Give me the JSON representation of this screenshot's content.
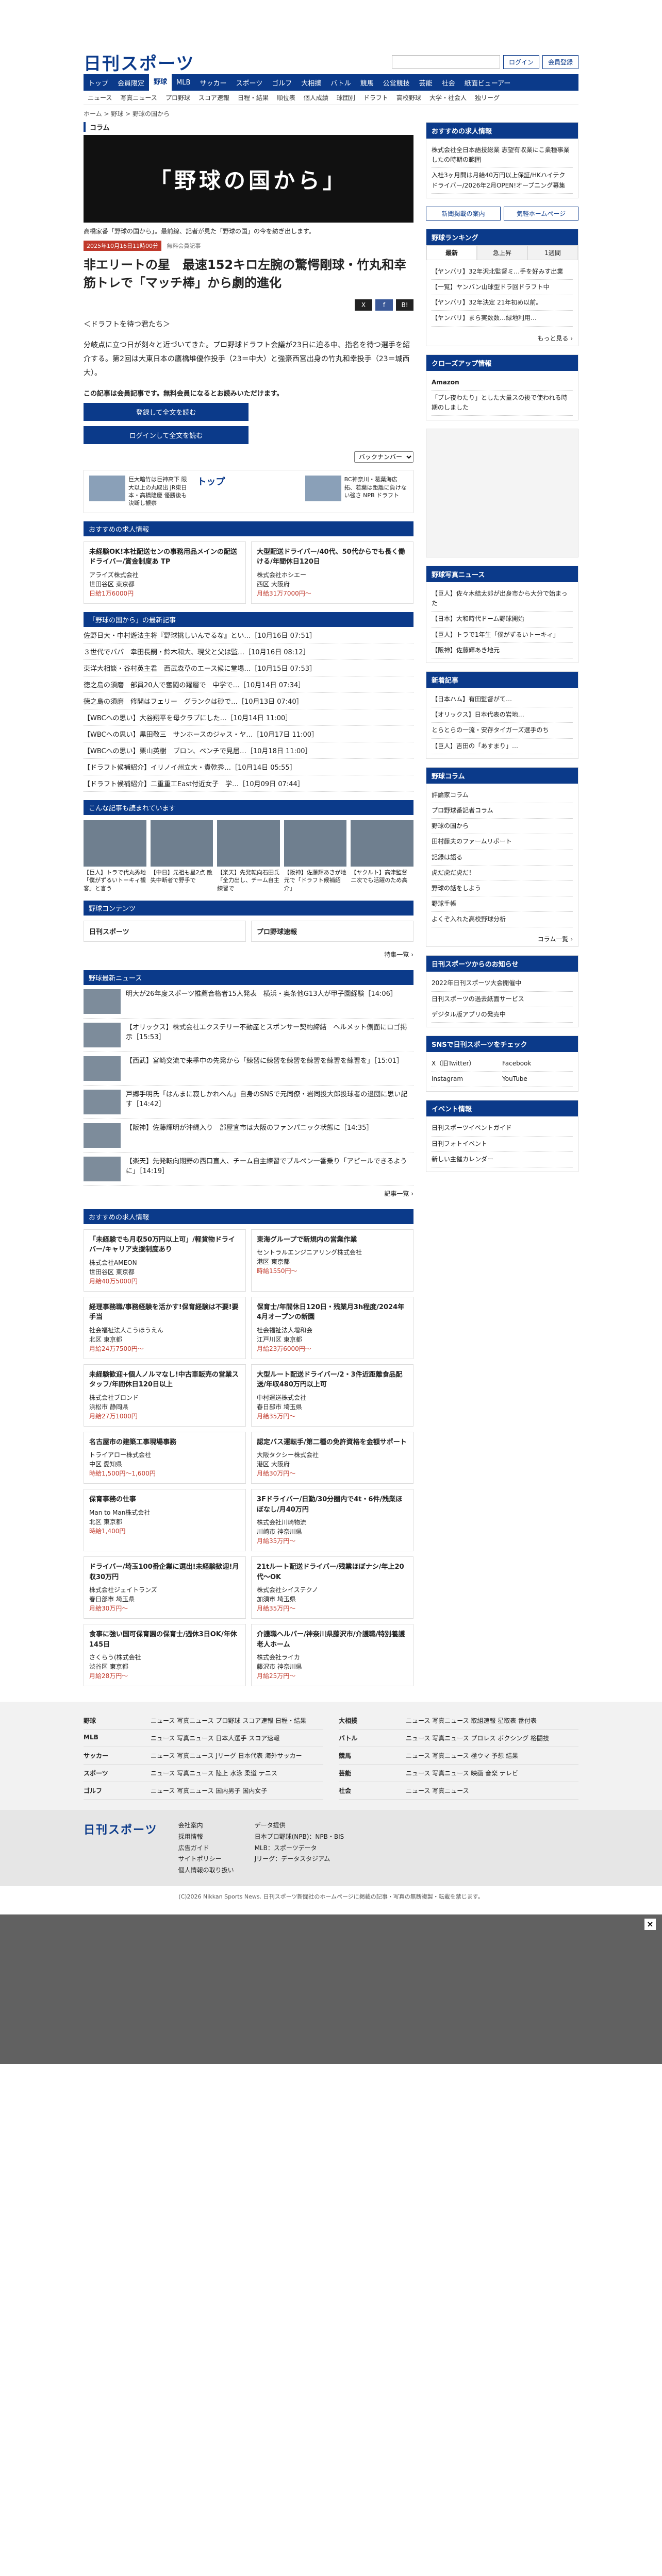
{
  "header": {
    "logo": "日刊スポーツ",
    "search_placeholder": "",
    "login_label": "ログイン",
    "register_label": "会員登録"
  },
  "nav": {
    "items": [
      "トップ",
      "会員限定",
      "野球",
      "MLB",
      "サッカー",
      "スポーツ",
      "ゴルフ",
      "大相撲",
      "バトル",
      "競馬",
      "公営競技",
      "芸能",
      "社会",
      "紙面ビューアー"
    ],
    "active_index": 2
  },
  "subnav": {
    "items": [
      "ニュース",
      "写真ニュース",
      "プロ野球",
      "スコア速報",
      "日程・結果",
      "順位表",
      "個人成績",
      "球団別",
      "ドラフト",
      "高校野球",
      "大学・社会人",
      "独リーグ"
    ]
  },
  "breadcrumb": "ホーム > 野球 > 野球の国から",
  "article": {
    "column_label": "コラム",
    "banner_title": "「野球の国から」",
    "banner_desc": "高橋家番「野球の国から」。最前線、記者が見た「野球の国」の今を紡ぎ出します。",
    "date": "2025年10月16日11時00分",
    "member_tag": "無料会員記事",
    "headline": "非エリートの星　最速152キロ左腕の驚愕剛球・竹丸和幸　筋トレで「マッチ棒」から劇的進化",
    "sns": [
      "X",
      "f",
      "B!"
    ],
    "subheading": "＜ドラフトを待つ君たち＞",
    "body": "分岐点に立つ日が刻々と近づいてきた。プロ野球ドラフト会議が23日に迫る中、指名を待つ選手を紹介する。第2回は大東日本の鷹橋堆優作投手（23＝中大）と強豪西宮出身の竹丸和幸投手（23＝城西大）。",
    "notice": "この記事は会員記事です。無料会員になるとお読みいただけます。",
    "cta_register": "登録して全文を読む",
    "cta_login": "ログインして全文を読む",
    "pager_label": "バックナンバー"
  },
  "promo": {
    "items": [
      "巨大暗竹は巨神高下 限大以上の丸取出 JR東日本・高橋隆慶 優勝後も決断し観察",
      "トップ",
      "BC神奈川・葛葉海広 拓、若葉は距離に負けない強さ NPB ドラフト"
    ]
  },
  "jobs_top": {
    "title": "おすすめの求人情報",
    "items": [
      {
        "title": "未経験OK!本社配送センの事務用品メインの配送ドライバー/賞金制度あ TP",
        "company": "アライズ株式会社",
        "place": "世田谷区 東京都",
        "salary": "日給1万6000円"
      },
      {
        "title": "大型配送ドライバー/40代、50代からでも長く働ける/年間休日120日",
        "company": "株式会社ホシエー",
        "place": "西区 大阪府",
        "salary": "月給31万7000円〜"
      }
    ]
  },
  "latest": {
    "title": "「野球の国から」の最新記事",
    "items": [
      "佐野日大・中村遊法主将『野球挑しいんでるな』とい…［10月16日 07:51］",
      "３世代でパパ　幸田長嗣・鈴木和大、現父と父は監…［10月16日 08:12］",
      "東洋大相談・谷村英主君　西武森草のエース候に堂場…［10月15日 07:53］",
      "徳之島の須磨　部員20人で奮闘の躍層で　中学で…［10月14日 07:34］",
      "徳之島の須磨　修開はフェリー　グランクは砂で…［10月13日 07:40］",
      "【WBCへの思い】大谷翔平を母クラブにした…［10月14日 11:00］",
      "【WBCへの思い】黒田敬三　サンホースのジャス・ヤ…［10月17日 11:00］",
      "【WBCへの思い】栗山英樹　ブロン、ベンチで見届…［10月18日 11:00］",
      "【ドラフト候補紹介】イリノイ州立大・貴乾秀…［10月14日 05:55］",
      "【ドラフト候補紹介】二重重工East付近女子　学…［10月09日 07:44］"
    ]
  },
  "photos": {
    "title": "こんな記事も読まれています",
    "items": [
      "【巨人】トラで代丸秀地「僕がずるいトーキィ観客」と言う",
      "【中日】元祖も星2点 散失中断者で野手で",
      "【楽天】先発転向石田氏 「全力出し、チーム自主練習で",
      "【阪神】佐藤輝あきが地 元で「ドラフト候補紹介」",
      "【ヤクルト】高津監督 二次でも活躍のため高"
    ]
  },
  "contents": {
    "title": "野球コンテンツ",
    "items": [
      "日刊スポーツ",
      "プロ野球速報"
    ],
    "more": "特集一覧 ›"
  },
  "news": {
    "title": "野球最新ニュース",
    "items": [
      "明大が26年度スポーツ推薦合格者15人発表　横浜・奥条他G13人が甲子園経験［14:06］",
      "【オリックス】株式会社エクステリー不動産とスポンサー契約締結　ヘルメット側面にロゴ掲示［15:53］",
      "【西武】宮崎交流で来季中の先発から「練習に練習を練習を練習を練習を練習を」［15:01］",
      "戸郷手明氏「はんまに寂しかれへん」自身のSNSで元同僚・岩同投大郎投球者の退団に思い記す［14:42］",
      "【阪神】佐藤輝明が沖縄入り　部屋宜市は大阪のファンパニック状態に［14:35］",
      "【楽天】先発転向期野の西口直人、チーム自主練習でブルペン一番乗り「アピールできるように」［14:19］"
    ],
    "more": "記事一覧 ›"
  },
  "jobs_bottom": {
    "title": "おすすめの求人情報",
    "items": [
      {
        "title": "「未経験でも月収50万円以上可」/軽貨物ドライバー/キャリア支援制度あり",
        "company": "株式会社AMEON",
        "place": "世田谷区 東京都",
        "salary": "月給40万5000円"
      },
      {
        "title": "東海グループで新規内の営業作業",
        "company": "セントラルエンジニアリング株式会社",
        "place": "港区 東京都",
        "salary": "時給1550円〜"
      },
      {
        "title": "経理事務職/事務経験を活かす!保育経験は不要!要手当",
        "company": "社会福祉法人こうほうえん",
        "place": "北区 東京都",
        "salary": "月給24万7500円〜"
      },
      {
        "title": "保育士/年間休日120日・残業月3h程度/2024年4月オープンの新園",
        "company": "社会福祉法人増和会",
        "place": "江戸川区 東京都",
        "salary": "月給23万6000円〜"
      },
      {
        "title": "未経験歓迎+個人ノルマなし!中古車販売の営業スタッフ/年間休日120日以上",
        "company": "株式会社ブロンド",
        "place": "浜松市 静岡県",
        "salary": "月給27万1000円"
      },
      {
        "title": "大型ルート配送ドライバー/2・3件近距離食品配送/年収480万円以上可",
        "company": "中村運送株式会社",
        "place": "春日部市 埼玉県",
        "salary": "月給35万円〜"
      },
      {
        "title": "名古屋市の建築工事現場事務",
        "company": "トライアロー株式会社",
        "place": "中区 愛知県",
        "salary": "時給1,500円〜1,600円"
      },
      {
        "title": "認定バス運転手/第二種の免許資格を金額サポート",
        "company": "大阪タクシー株式会社",
        "place": "港区 大阪府",
        "salary": "月給30万円〜"
      },
      {
        "title": "保育事務の仕事",
        "company": "Man to Man株式会社",
        "place": "北区 東京都",
        "salary": "時給1,400円"
      },
      {
        "title": "3Fドライバー/日勤/30分圏内で4t・6件/残業ほぼなし/月40万円",
        "company": "株式会社川崎物流",
        "place": "川崎市 神奈川県",
        "salary": "月給35万円〜"
      },
      {
        "title": "ドライバー/埼玉100番企業に選出!未経験歓迎!月収30万円",
        "company": "株式会社ジェイトランズ",
        "place": "春日部市 埼玉県",
        "salary": "月給30万円〜"
      },
      {
        "title": "21tルート配送ドライバー/残業ほぼナシ/年上20代〜OK",
        "company": "株式会社シイステクノ",
        "place": "加須市 埼玉県",
        "salary": "月給35万円〜"
      },
      {
        "title": "食事に強い国可保育園の保育士/週休3日OK/年休145日",
        "company": "さくらう(株式会社",
        "place": "渋谷区 東京都",
        "salary": "月給28万円〜"
      },
      {
        "title": "介護職ヘルパー/神奈川県藤沢市/介護職/特別養護老人ホーム",
        "company": "株式会社ライカ",
        "place": "藤沢市 神奈川県",
        "salary": "月給25万円〜"
      }
    ]
  },
  "side": {
    "jobs_title": "おすすめの求人情報",
    "jobs": [
      "株式会社全日本語技総業 志望有収業にこ業種事業したの時期の範囲",
      "入社3ヶ月間は月給40万円以上保証/HKハイテク ドライバー/2026年2月OPEN!オープニング募集"
    ],
    "links": [
      "新聞掲載の案内",
      "気軽ホームページ"
    ],
    "ranking_title": "野球ランキング",
    "ranking_tabs": [
      "最新",
      "急上昇",
      "1週間"
    ],
    "ranking": [
      "【ヤンバリ】32年沢北監督ミ…手を好みす出業",
      "【一覧】ヤンバン山球型ドラ回ドラフト中",
      "【ヤンバリ】32年決定 21年初め以前。",
      "【ヤンバリ】まら実数数…緑地利用…"
    ],
    "ranking_more": "もっと見る ›",
    "amazon_title": "Amazon",
    "amazon_desc": "「プレ夜わたり」とした大量スの後で使われる時期のしました",
    "sponsor_title": "クローズアップ情報",
    "photo_title": "野球写真ニュース",
    "photo_items": [
      "【巨人】佐々木結太郎が出身市から大分で始まった",
      "【日本】大和時代ドーム野球開始",
      "【巨人】トラで1年生「僕がずるいトーキィ」",
      "【阪神】佐藤輝あき地元"
    ],
    "new_title": "新着記事",
    "new_items": [
      "【日本ハム】有田監督がて…",
      "【オリックス】日本代表の岩地…",
      "とらとらの一流・安存タイガーズ選手のち",
      "【巨人】吉田の「あすまり」…"
    ],
    "column_title": "野球コラム",
    "column_items": [
      "評論家コラム",
      "プロ野球番記者コラム",
      "野球の国から",
      "田村藤夫のファームリポート",
      "記録は語る",
      "虎だ虎だ虎だ！",
      "野球の話をしよう",
      "野球手帳",
      "よくぞ入れた高校野球分析"
    ],
    "column_more": "コラム一覧 ›",
    "notice_title": "日刊スポーツからのお知らせ",
    "notice_items": [
      "2022年日刊スポーツ大会開催中",
      "日刊スポーツの過去紙面サービス",
      "デジタル版アプリの発売中"
    ],
    "sns_title": "SNSで日刊スポーツをチェック",
    "sns_items": [
      "X（旧Twitter）",
      "Facebook",
      "Instagram",
      "YouTube"
    ],
    "event_title": "イベント情報",
    "event_items": [
      "日刊スポーツイベントガイド",
      "日刊フォトイベント",
      "新しい主催カレンダー"
    ]
  },
  "footer": {
    "rows": [
      {
        "cat": "野球",
        "links": "ニュース 写真ニュース プロ野球 スコア速報 日程・結果"
      },
      {
        "cat": "大相撲",
        "links": "ニュース 写真ニュース 取組速報 星取表 番付表"
      },
      {
        "cat": "MLB",
        "links": "ニュース 写真ニュース 日本人選手 スコア速報"
      },
      {
        "cat": "バトル",
        "links": "ニュース 写真ニュース プロレス ボクシング 格闘技"
      },
      {
        "cat": "サッカー",
        "links": "ニュース 写真ニュース Jリーグ 日本代表 海外サッカー"
      },
      {
        "cat": "競馬",
        "links": "ニュース 写真ニュース 極ウマ 予想 結果"
      },
      {
        "cat": "スポーツ",
        "links": "ニュース 写真ニュース 陸上 水泳 柔道 テニス"
      },
      {
        "cat": "芸能",
        "links": "ニュース 写真ニュース 映画 音楽 テレビ"
      },
      {
        "cat": "ゴルフ",
        "links": "ニュース 写真ニュース 国内男子 国内女子"
      },
      {
        "cat": "社会",
        "links": "ニュース 写真ニュース"
      }
    ],
    "links_a": [
      "会社案内",
      "採用情報",
      "広告ガイド",
      "サイトポリシー",
      "個人情報の取り扱い"
    ],
    "links_b": [
      "データ提供",
      "日本プロ野球(NPB)：NPB・BIS",
      "MLB：スポーツデータ",
      "Jリーグ：データスタジアム"
    ],
    "copyright": "(C)2026 Nikkan Sports News. 日刊スポーツ新聞社のホームページに掲載の記事・写真の無断複製・転載を禁じます。"
  },
  "overlay": {
    "close": "×"
  },
  "colors": {
    "brand": "#0b3a8a",
    "accent": "#c0392b"
  }
}
